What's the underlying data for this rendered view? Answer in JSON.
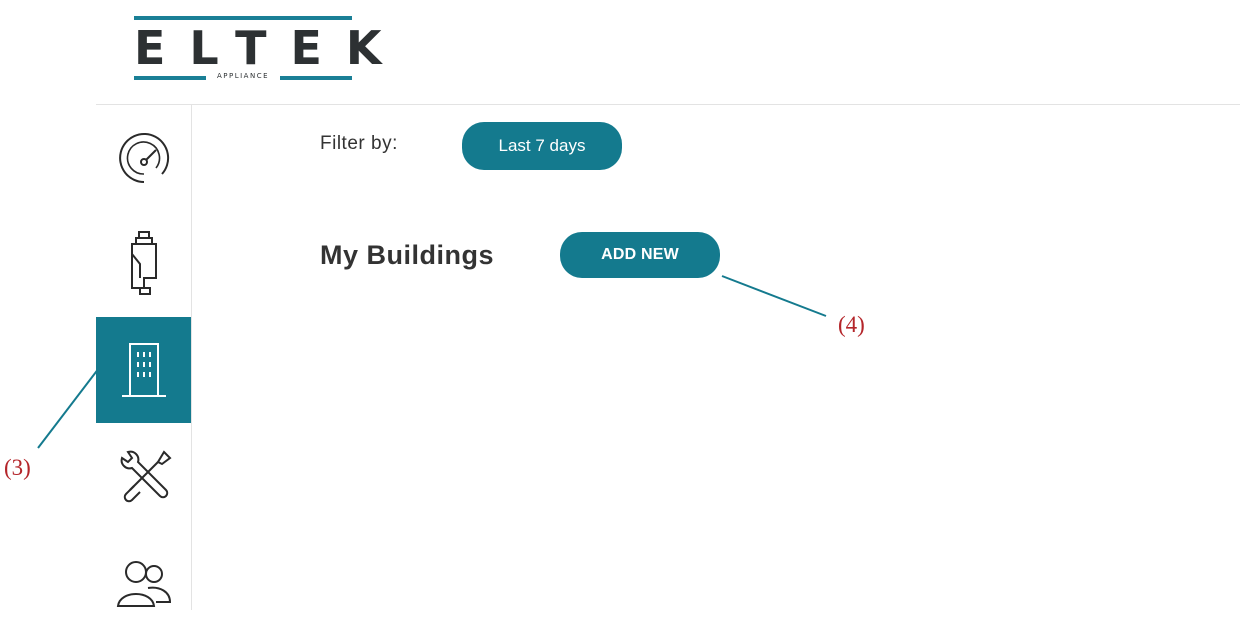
{
  "logo": {
    "wordmark": "ELTEK",
    "sub": "APPLIANCE"
  },
  "sidebar": {
    "items": [
      {
        "icon": "speedometer-icon",
        "active": false
      },
      {
        "icon": "device-icon",
        "active": false
      },
      {
        "icon": "building-icon",
        "active": true
      },
      {
        "icon": "tools-icon",
        "active": false
      },
      {
        "icon": "users-icon",
        "active": false
      }
    ]
  },
  "filter": {
    "label": "Filter by:",
    "value": "Last 7 days"
  },
  "section": {
    "title": "My Buildings",
    "add_label": "ADD NEW"
  },
  "callouts": {
    "sidebar_building": "(3)",
    "add_new": "(4)"
  },
  "colors": {
    "accent": "#147a8e",
    "callout": "#b4252a",
    "logo_bar": "#1a7f96"
  }
}
